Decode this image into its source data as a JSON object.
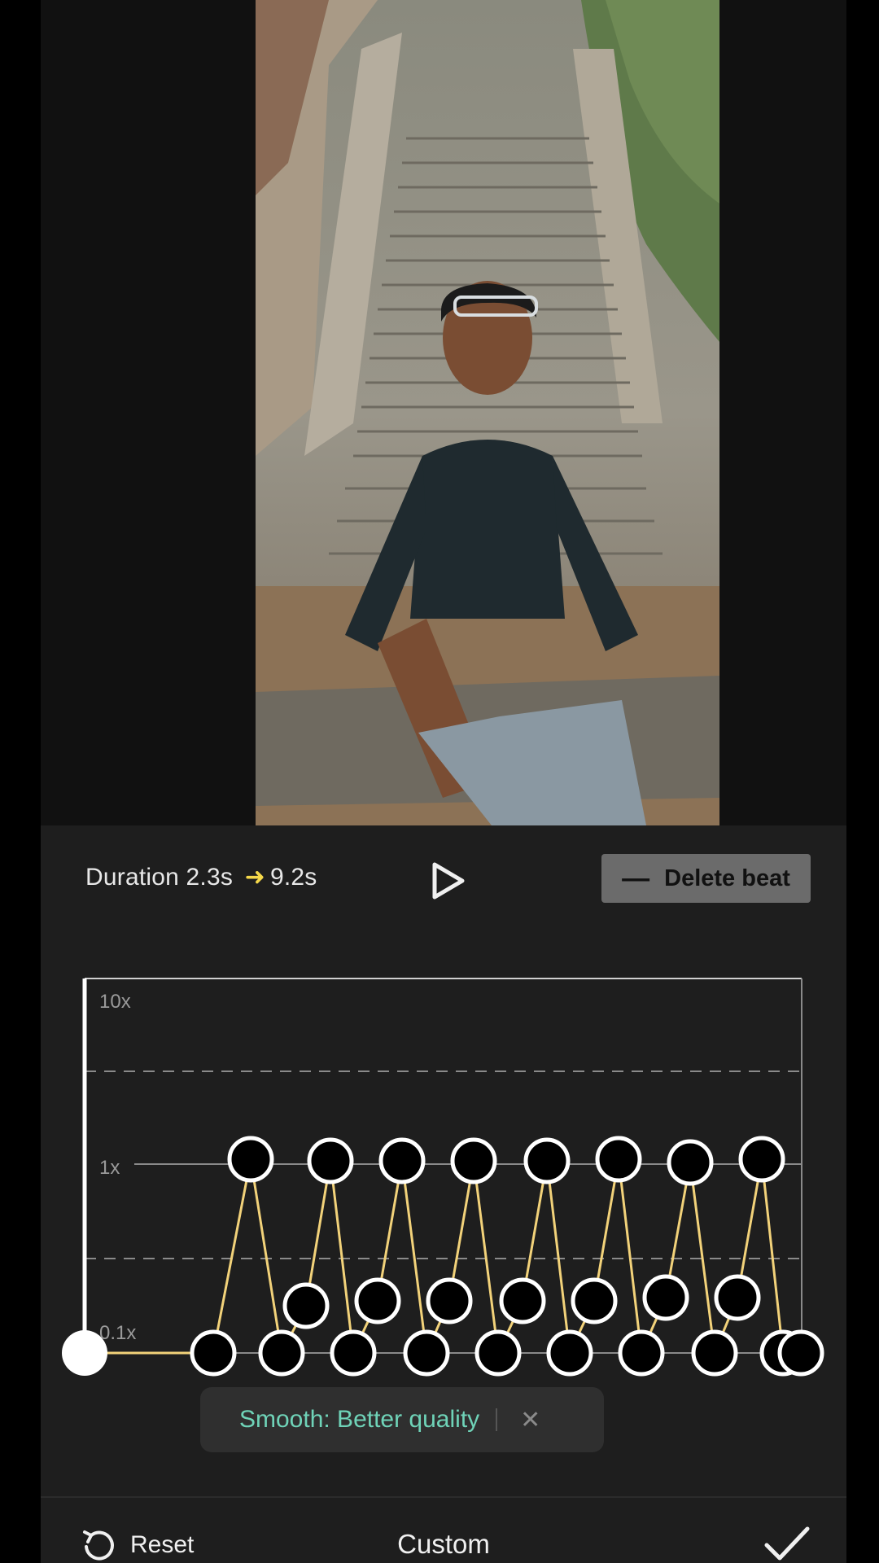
{
  "editor": {
    "duration_label": "Duration",
    "duration_from": "2.3s",
    "duration_arrow": "➜",
    "duration_to": "9.2s",
    "delete_label": "Delete beat",
    "play_icon": "play-icon",
    "minus_icon": "minus-icon"
  },
  "curve": {
    "y_labels": [
      "10x",
      "1x",
      "0.1x"
    ],
    "line_color": "#f2d27a",
    "point_fill": "#000000",
    "point_stroke": "#ffffff",
    "playhead_color": "#ffffff"
  },
  "toast": {
    "message": "Smooth: Better quality",
    "close_icon": "close-icon",
    "text_color": "#6fd3b8"
  },
  "bottom_bar": {
    "reset_label": "Reset",
    "mode_label": "Custom",
    "reset_icon": "undo-icon",
    "confirm_icon": "check-icon"
  }
}
